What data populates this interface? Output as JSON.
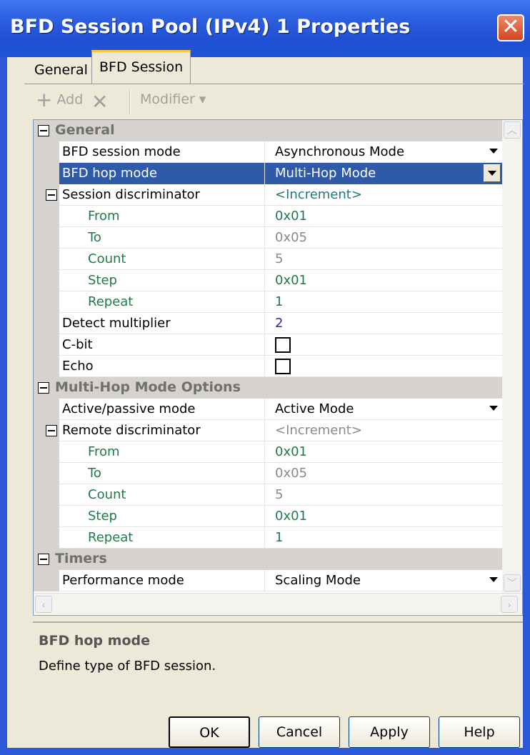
{
  "window": {
    "title": "BFD Session Pool (IPv4) 1 Properties",
    "close_glyph": "✕"
  },
  "tabs": [
    {
      "label": "General",
      "active": false
    },
    {
      "label": "BFD Session",
      "active": true
    }
  ],
  "toolbar": {
    "add_label": "Add",
    "add_glyph": "+",
    "delete_glyph": "✕",
    "modifier_label": "Modifier ▾"
  },
  "grid": {
    "sections": {
      "general": "General",
      "multihop": "Multi-Hop Mode Options",
      "timers": "Timers"
    },
    "general": {
      "session_mode": {
        "label": "BFD session mode",
        "value": "Asynchronous Mode"
      },
      "hop_mode": {
        "label": "BFD hop mode",
        "value": "Multi-Hop Mode"
      },
      "session_disc": {
        "label": "Session discriminator",
        "value": "<Increment>"
      },
      "sd_from": {
        "label": "From",
        "value": "0x01"
      },
      "sd_to": {
        "label": "To",
        "value": "0x05"
      },
      "sd_count": {
        "label": "Count",
        "value": "5"
      },
      "sd_step": {
        "label": "Step",
        "value": "0x01"
      },
      "sd_repeat": {
        "label": "Repeat",
        "value": "1"
      },
      "detect_mult": {
        "label": "Detect multiplier",
        "value": "2"
      },
      "cbit": {
        "label": "C-bit",
        "checked": false
      },
      "echo": {
        "label": "Echo",
        "checked": false
      }
    },
    "multihop": {
      "active_passive": {
        "label": "Active/passive mode",
        "value": "Active Mode"
      },
      "remote_disc": {
        "label": "Remote discriminator",
        "value": "<Increment>"
      },
      "rd_from": {
        "label": "From",
        "value": "0x01"
      },
      "rd_to": {
        "label": "To",
        "value": "0x05"
      },
      "rd_count": {
        "label": "Count",
        "value": "5"
      },
      "rd_step": {
        "label": "Step",
        "value": "0x01"
      },
      "rd_repeat": {
        "label": "Repeat",
        "value": "1"
      }
    },
    "timers": {
      "performance_mode": {
        "label": "Performance mode",
        "value": "Scaling Mode"
      }
    },
    "selected_row": "BFD hop mode"
  },
  "description": {
    "title": "BFD hop mode",
    "text": "Define type of BFD session."
  },
  "buttons": {
    "ok": "OK",
    "cancel": "Cancel",
    "apply": "Apply",
    "help": "Help"
  },
  "colors": {
    "titlebar": "#2c5ee0",
    "selection": "#2f5aa8",
    "child_label": "#227a4a"
  }
}
